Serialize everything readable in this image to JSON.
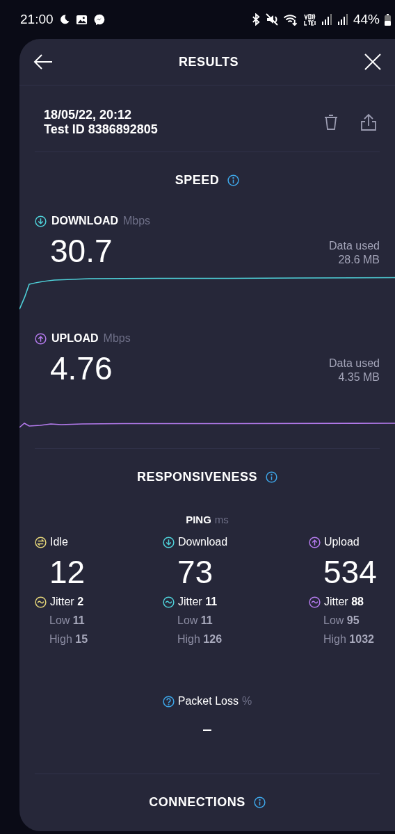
{
  "status_bar": {
    "time": "21:00",
    "battery": "44%"
  },
  "header": {
    "title": "RESULTS"
  },
  "test": {
    "date": "18/05/22, 20:12",
    "test_id": "Test ID 8386892805"
  },
  "speed": {
    "title": "SPEED",
    "metrics": [
      {
        "kind": "download",
        "label": "DOWNLOAD",
        "unit": "Mbps",
        "value": "30.7",
        "data_used_label": "Data used",
        "data_used": "28.6 MB",
        "color": "#4fd1d9"
      },
      {
        "kind": "upload",
        "label": "UPLOAD",
        "unit": "Mbps",
        "value": "4.76",
        "data_used_label": "Data used",
        "data_used": "4.35 MB",
        "color": "#b57bee"
      }
    ]
  },
  "responsiveness": {
    "title": "RESPONSIVENESS",
    "ping_label": "PING",
    "ping_unit": "ms",
    "columns": [
      {
        "kind": "idle",
        "label": "Idle",
        "value": "12",
        "jitter": "Jitter **2**",
        "low": "Low **11**",
        "high": "High **15**",
        "color": "#e6d77a"
      },
      {
        "kind": "download",
        "label": "Download",
        "value": "73",
        "jitter": "Jitter **11**",
        "low": "Low **11**",
        "high": "High **126**",
        "color": "#4fd1d9"
      },
      {
        "kind": "upload",
        "label": "Upload",
        "value": "534",
        "jitter": "Jitter **88**",
        "low": "Low **95**",
        "high": "High **1032**",
        "color": "#b57bee"
      }
    ],
    "packet_loss": {
      "label": "Packet Loss",
      "unit": "%",
      "value": "–"
    }
  },
  "connections": {
    "title": "CONNECTIONS"
  }
}
